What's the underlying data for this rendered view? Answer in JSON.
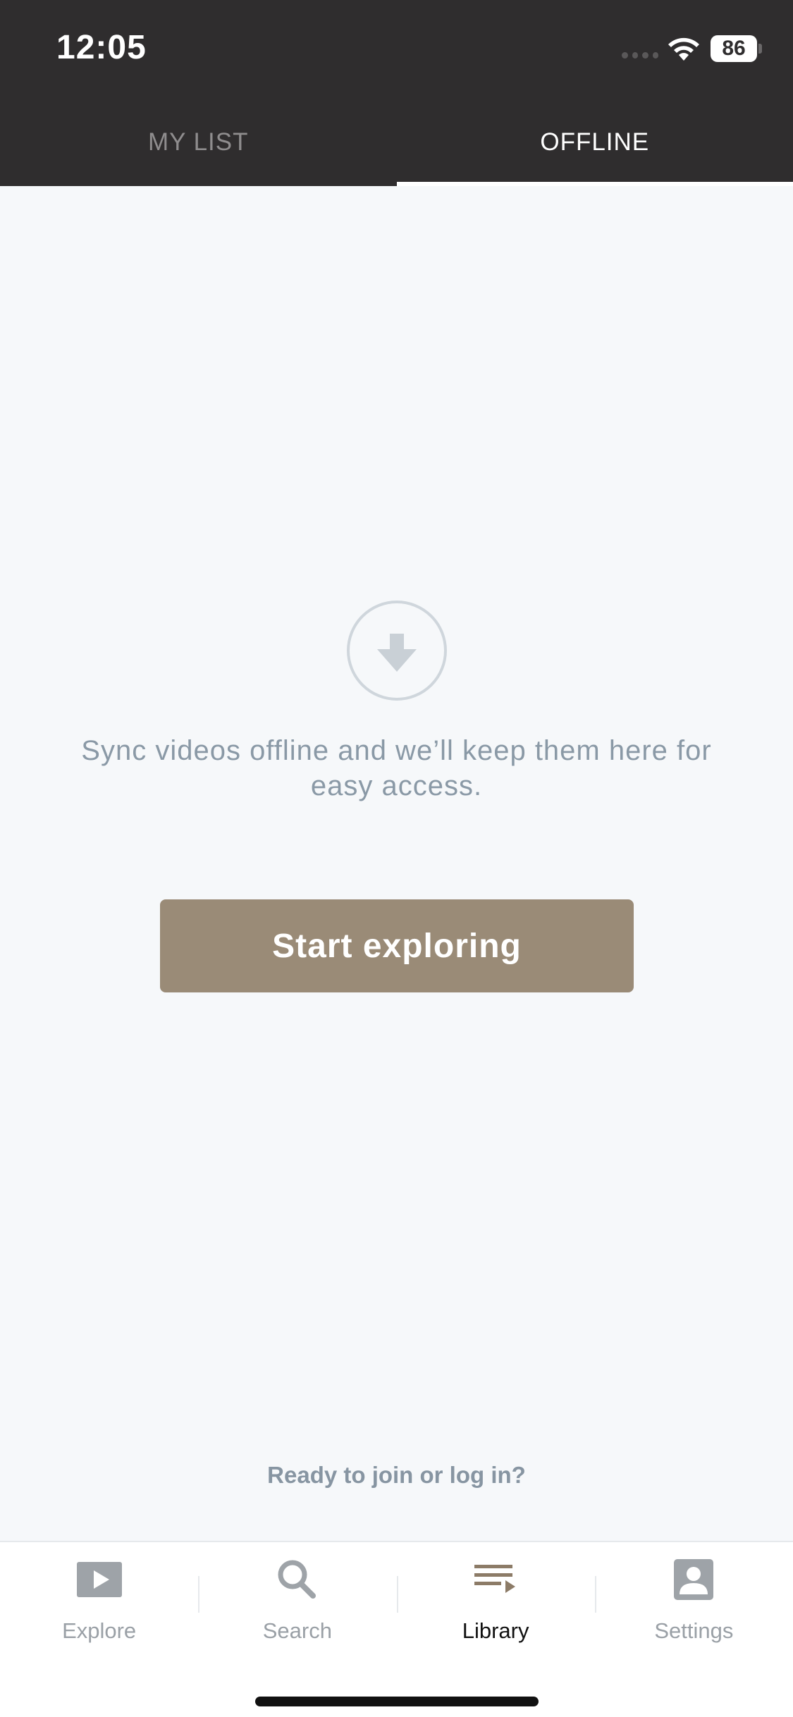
{
  "status_bar": {
    "time": "12:05",
    "battery": "86",
    "icons": [
      "signal-icon",
      "wifi-icon",
      "battery-icon"
    ]
  },
  "top_tabs": [
    {
      "label": "MY LIST",
      "active": false
    },
    {
      "label": "OFFLINE",
      "active": true
    }
  ],
  "empty_state": {
    "icon": "download-icon",
    "message": "Sync videos offline and we’ll keep them here for easy access.",
    "button_label": "Start exploring"
  },
  "join_prompt": "Ready to join or log in?",
  "bottom_nav": [
    {
      "label": "Explore",
      "icon": "play-icon",
      "active": false
    },
    {
      "label": "Search",
      "icon": "search-icon",
      "active": false
    },
    {
      "label": "Library",
      "icon": "library-icon",
      "active": true
    },
    {
      "label": "Settings",
      "icon": "profile-icon",
      "active": false
    }
  ],
  "colors": {
    "header_bg": "#2f2d2e",
    "page_bg": "#f6f8fa",
    "accent_button": "#9a8b77",
    "library_icon": "#8c7b67",
    "muted_text": "#8a99a6"
  }
}
